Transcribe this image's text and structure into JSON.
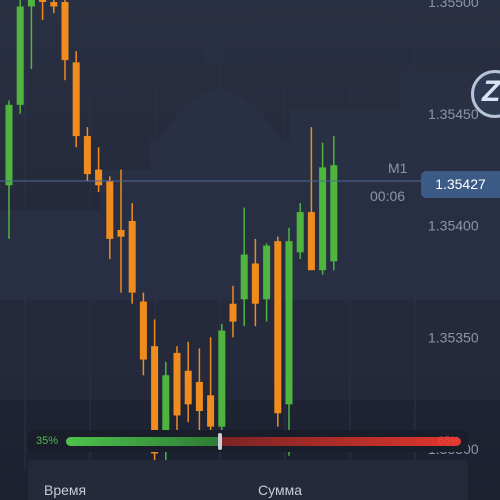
{
  "price_axis": {
    "labels": [
      "1.35500",
      "1.35450",
      "1.35400",
      "1.35350",
      "1.35300"
    ]
  },
  "current": {
    "timeframe": "M1",
    "timer": "00:06",
    "price": "1.35427"
  },
  "sentiment": {
    "left_label": "35%",
    "right_label": "65%",
    "buy_fraction": 0.35,
    "buy_color": "#4cbb4c",
    "sell_color": "#e24a3f"
  },
  "bottom_panel": {
    "time_label": "Время",
    "amount_label": "Сумма"
  },
  "colors": {
    "up": "#4fb53f",
    "down": "#f08c1e",
    "background": "#1f2435",
    "grid": "#2c3246"
  },
  "chart_data": {
    "type": "candlestick",
    "price_range": [
      1.3529,
      1.3551
    ],
    "candles": [
      {
        "o": 1.35418,
        "h": 1.35456,
        "l": 1.35394,
        "c": 1.35454
      },
      {
        "o": 1.35454,
        "h": 1.35504,
        "l": 1.3545,
        "c": 1.35498
      },
      {
        "o": 1.35498,
        "h": 1.35505,
        "l": 1.3547,
        "c": 1.35503
      },
      {
        "o": 1.35502,
        "h": 1.3551,
        "l": 1.35492,
        "c": 1.355
      },
      {
        "o": 1.355,
        "h": 1.3551,
        "l": 1.35495,
        "c": 1.35498
      },
      {
        "o": 1.355,
        "h": 1.35505,
        "l": 1.35465,
        "c": 1.35474
      },
      {
        "o": 1.35473,
        "h": 1.35478,
        "l": 1.35435,
        "c": 1.3544
      },
      {
        "o": 1.3544,
        "h": 1.35444,
        "l": 1.3542,
        "c": 1.35423
      },
      {
        "o": 1.35425,
        "h": 1.35435,
        "l": 1.35415,
        "c": 1.35418
      },
      {
        "o": 1.3542,
        "h": 1.35422,
        "l": 1.35385,
        "c": 1.35394
      },
      {
        "o": 1.35398,
        "h": 1.35425,
        "l": 1.3537,
        "c": 1.35395
      },
      {
        "o": 1.35402,
        "h": 1.3541,
        "l": 1.35365,
        "c": 1.3537
      },
      {
        "o": 1.35366,
        "h": 1.3537,
        "l": 1.35333,
        "c": 1.3534
      },
      {
        "o": 1.35346,
        "h": 1.35358,
        "l": 1.35292,
        "c": 1.35298
      },
      {
        "o": 1.353,
        "h": 1.35339,
        "l": 1.35295,
        "c": 1.35333
      },
      {
        "o": 1.35343,
        "h": 1.35346,
        "l": 1.35306,
        "c": 1.35315
      },
      {
        "o": 1.35335,
        "h": 1.35348,
        "l": 1.35312,
        "c": 1.3532
      },
      {
        "o": 1.3533,
        "h": 1.35345,
        "l": 1.35305,
        "c": 1.35317
      },
      {
        "o": 1.35324,
        "h": 1.3535,
        "l": 1.35303,
        "c": 1.3531
      },
      {
        "o": 1.3531,
        "h": 1.35356,
        "l": 1.35305,
        "c": 1.35353
      },
      {
        "o": 1.35365,
        "h": 1.35373,
        "l": 1.3535,
        "c": 1.35357
      },
      {
        "o": 1.35367,
        "h": 1.35408,
        "l": 1.35355,
        "c": 1.35387
      },
      {
        "o": 1.35383,
        "h": 1.35394,
        "l": 1.35355,
        "c": 1.35365
      },
      {
        "o": 1.35367,
        "h": 1.35392,
        "l": 1.35357,
        "c": 1.35391
      },
      {
        "o": 1.35393,
        "h": 1.35395,
        "l": 1.3531,
        "c": 1.35316
      },
      {
        "o": 1.3532,
        "h": 1.35399,
        "l": 1.35297,
        "c": 1.35393
      },
      {
        "o": 1.35388,
        "h": 1.3541,
        "l": 1.35385,
        "c": 1.35406
      },
      {
        "o": 1.35406,
        "h": 1.35444,
        "l": 1.35395,
        "c": 1.3538
      },
      {
        "o": 1.3538,
        "h": 1.35437,
        "l": 1.35378,
        "c": 1.35426
      },
      {
        "o": 1.35384,
        "h": 1.3544,
        "l": 1.3538,
        "c": 1.35427
      }
    ]
  }
}
